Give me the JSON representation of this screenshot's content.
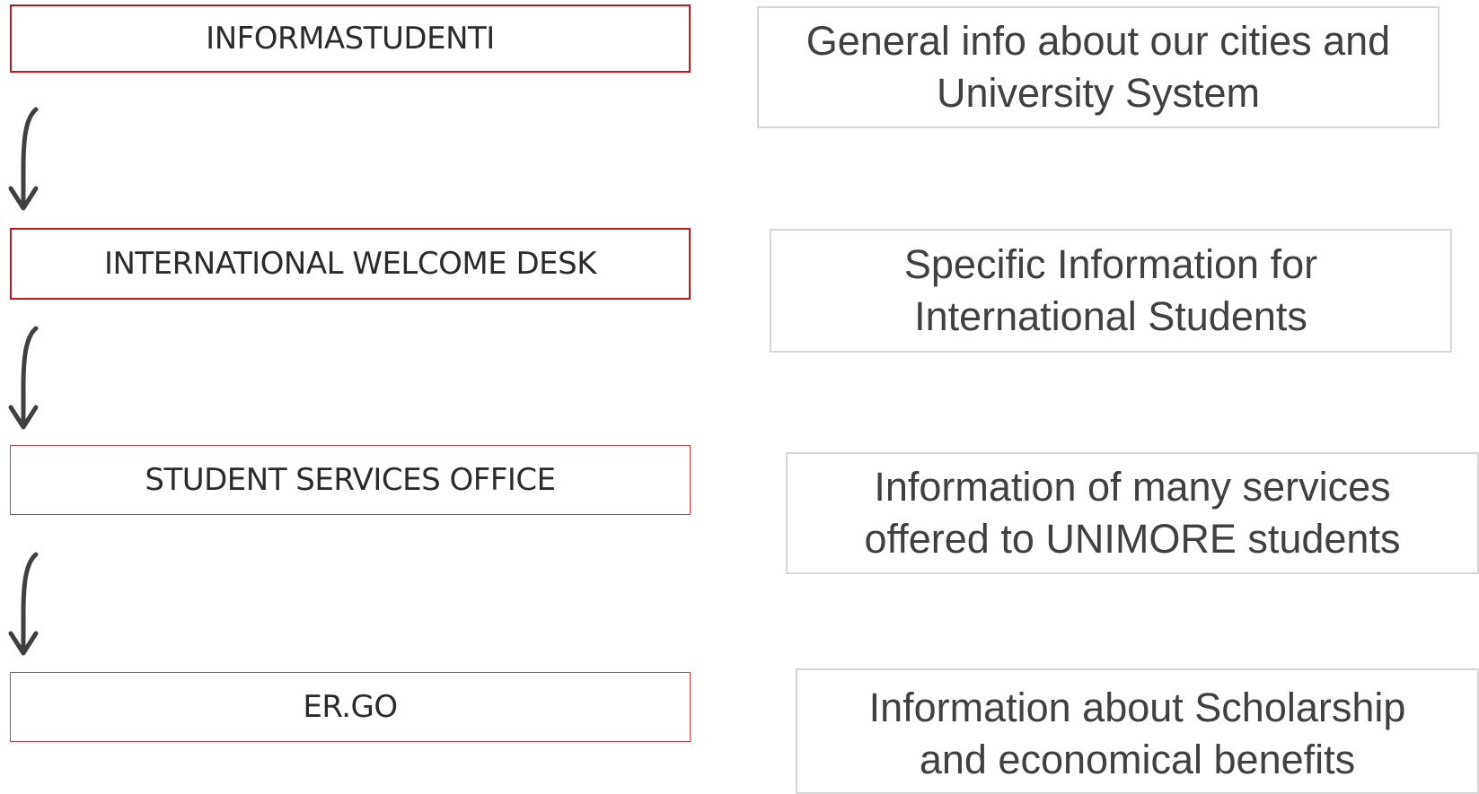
{
  "steps": [
    {
      "label": "INFORMASTUDENTI",
      "description": "General info about our cities and\nUniversity System"
    },
    {
      "label": "INTERNATIONAL WELCOME DESK",
      "description": "Specific Information for\nInternational Students"
    },
    {
      "label": "STUDENT SERVICES OFFICE",
      "description": "Information of many services\noffered to UNIMORE students"
    },
    {
      "label": "ER.GO",
      "description": "Information about Scholarship\nand economical benefits"
    }
  ],
  "colors": {
    "step_border": "#c0171e",
    "info_border": "#d6d6d6",
    "arrow": "#404040",
    "text": "#404040"
  }
}
